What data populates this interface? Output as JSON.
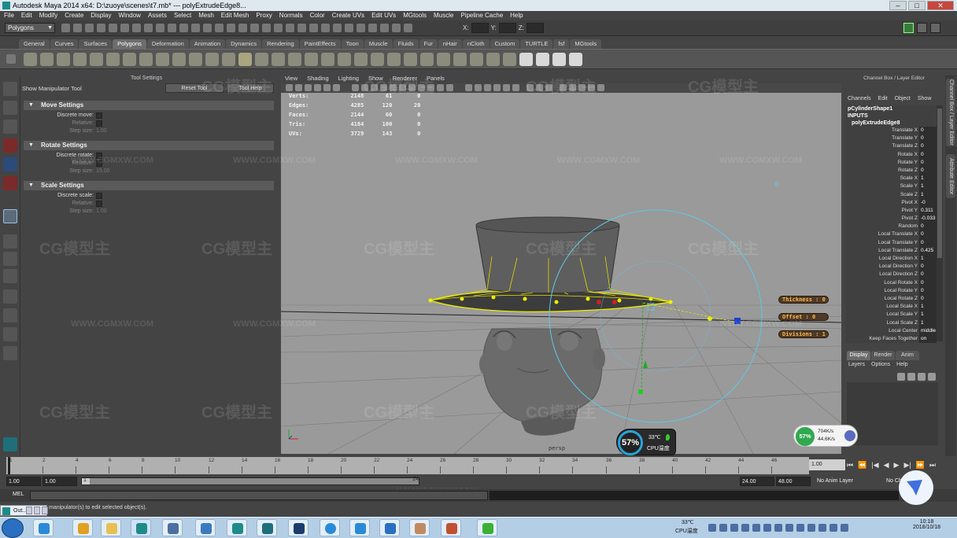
{
  "window": {
    "title": "Autodesk Maya 2014 x64: D:\\zuoye\\scenes\\t7.mb*   ---   polyExtrudeEdge8..."
  },
  "menubar": [
    "File",
    "Edit",
    "Modify",
    "Create",
    "Display",
    "Window",
    "Assets",
    "Select",
    "Mesh",
    "Edit Mesh",
    "Proxy",
    "Normals",
    "Color",
    "Create UVs",
    "Edit UVs",
    "MGtools",
    "Muscle",
    "Pipeline Cache",
    "Help"
  ],
  "status_line": {
    "mode": "Polygons",
    "x_label": "X:",
    "y_label": "Y:",
    "z_label": "Z:"
  },
  "shelf_tabs": [
    {
      "label": "General"
    },
    {
      "label": "Curves"
    },
    {
      "label": "Surfaces"
    },
    {
      "label": "Polygons",
      "active": true
    },
    {
      "label": "Deformation"
    },
    {
      "label": "Animation"
    },
    {
      "label": "Dynamics"
    },
    {
      "label": "Rendering"
    },
    {
      "label": "PaintEffects"
    },
    {
      "label": "Toon"
    },
    {
      "label": "Muscle"
    },
    {
      "label": "Fluids"
    },
    {
      "label": "Fur"
    },
    {
      "label": "nHair"
    },
    {
      "label": "nCloth"
    },
    {
      "label": "Custom"
    },
    {
      "label": "TURTLE"
    },
    {
      "label": "fsf"
    },
    {
      "label": "MGtools"
    }
  ],
  "tool_settings": {
    "title": "Tool Settings",
    "tool_name": "Show Manipulator Tool",
    "reset_label": "Reset Tool",
    "help_label": "Tool Help",
    "sections": [
      {
        "title": "Move Settings",
        "rows": [
          {
            "label": "Discrete move:",
            "kind": "check"
          },
          {
            "label": "Relative:",
            "kind": "check",
            "dim": true
          },
          {
            "label": "Step size:",
            "kind": "value",
            "value": "1.00",
            "dim": true
          }
        ]
      },
      {
        "title": "Rotate Settings",
        "rows": [
          {
            "label": "Discrete rotate:",
            "kind": "check"
          },
          {
            "label": "Relative:",
            "kind": "check",
            "dim": true
          },
          {
            "label": "Step size:",
            "kind": "value",
            "value": "15.00",
            "dim": true
          }
        ]
      },
      {
        "title": "Scale Settings",
        "rows": [
          {
            "label": "Discrete scale:",
            "kind": "check"
          },
          {
            "label": "Relative:",
            "kind": "check",
            "dim": true
          },
          {
            "label": "Step size:",
            "kind": "value",
            "value": "1.00",
            "dim": true
          }
        ]
      }
    ]
  },
  "viewport": {
    "menu": [
      "View",
      "Shading",
      "Lighting",
      "Show",
      "Renderer",
      "Panels"
    ],
    "camera": "persp",
    "hud": [
      {
        "label": "Verts:",
        "a": "2148",
        "b": "61",
        "c": "0"
      },
      {
        "label": "Edges:",
        "a": "4285",
        "b": "120",
        "c": "20"
      },
      {
        "label": "Faces:",
        "a": "2144",
        "b": "60",
        "c": "0"
      },
      {
        "label": "Tris:",
        "a": "4184",
        "b": "100",
        "c": "0"
      },
      {
        "label": "UVs:",
        "a": "3729",
        "b": "143",
        "c": "0"
      }
    ],
    "in_view_attrs": [
      {
        "label": "Thickness",
        "value": "0"
      },
      {
        "label": "Offset",
        "value": "0"
      },
      {
        "label": "Divisions",
        "value": "1"
      }
    ]
  },
  "channel_box": {
    "title": "Channel Box / Layer Editor",
    "menu": [
      "Channels",
      "Edit",
      "Object",
      "Show"
    ],
    "object": "pCylinderShape1",
    "inputs_label": "INPUTS",
    "node": "polyExtrudeEdge8",
    "attributes": [
      {
        "name": "Translate X",
        "value": "0"
      },
      {
        "name": "Translate Y",
        "value": "0"
      },
      {
        "name": "Translate Z",
        "value": "0"
      },
      {
        "name": "Rotate X",
        "value": "0"
      },
      {
        "name": "Rotate Y",
        "value": "0"
      },
      {
        "name": "Rotate Z",
        "value": "0"
      },
      {
        "name": "Scale X",
        "value": "1"
      },
      {
        "name": "Scale Y",
        "value": "1"
      },
      {
        "name": "Scale Z",
        "value": "1"
      },
      {
        "name": "Pivot X",
        "value": "-0"
      },
      {
        "name": "Pivot Y",
        "value": "0.311"
      },
      {
        "name": "Pivot Z",
        "value": "-0.033"
      },
      {
        "name": "Random",
        "value": "0"
      },
      {
        "name": "Local Translate X",
        "value": "0"
      },
      {
        "name": "Local Translate Y",
        "value": "0"
      },
      {
        "name": "Local Translate Z",
        "value": "0.425"
      },
      {
        "name": "Local Direction X",
        "value": "1"
      },
      {
        "name": "Local Direction Y",
        "value": "0"
      },
      {
        "name": "Local Direction Z",
        "value": "0"
      },
      {
        "name": "Local Rotate X",
        "value": "0"
      },
      {
        "name": "Local Rotate Y",
        "value": "0"
      },
      {
        "name": "Local Rotate Z",
        "value": "0"
      },
      {
        "name": "Local Scale X",
        "value": "1"
      },
      {
        "name": "Local Scale Y",
        "value": "1"
      },
      {
        "name": "Local Scale Z",
        "value": "1"
      },
      {
        "name": "Local Center",
        "value": "middle"
      },
      {
        "name": "Keep Faces Together",
        "value": "on"
      }
    ]
  },
  "side_tabs": [
    "Channel Box / Layer Editor",
    "Attribute Editor"
  ],
  "layer_editor": {
    "tabs": [
      "Display",
      "Render",
      "Anim"
    ],
    "menu": [
      "Layers",
      "Options",
      "Help"
    ]
  },
  "timeline": {
    "ticks": [
      "1",
      "2",
      "4",
      "6",
      "8",
      "10",
      "12",
      "14",
      "16",
      "18",
      "20",
      "22",
      "24",
      "26",
      "28",
      "30",
      "32",
      "34",
      "36",
      "38",
      "40",
      "42",
      "44",
      "46"
    ],
    "current_frame": "1.00",
    "range": {
      "start": "1.00",
      "inner_start": "1.00",
      "slider_start": "1",
      "slider_end": "24",
      "end": "24.00",
      "outer_end": "48.00"
    },
    "anim_layer": "No Anim Layer",
    "char_set": "No Ch"
  },
  "command_line": {
    "label": "MEL"
  },
  "help_line": {
    "text": "manipulator(s) to edit selected object(s)."
  },
  "minimized": {
    "label": "Out..."
  },
  "cpu_widget": {
    "percent": "57%",
    "temperature": "33℃",
    "label": "CPU温度"
  },
  "net_widget": {
    "percent": "57%",
    "up": "704K/s",
    "down": "44.6K/s"
  },
  "taskbar": {
    "tray_temp": "33℃",
    "tray_label": "CPU温度",
    "time": "10:18",
    "date": "2018/10/18"
  },
  "watermark": {
    "brand": "CG模型主",
    "url": "WWW.CGMXW.COM"
  },
  "colors": {
    "viewport_bg": "#9a9a9a",
    "ui_bg": "#444444",
    "selection_yellow": "#f0f000",
    "manip_cyan": "#5fc8e8",
    "hud_attr_orange": "#ffb64a"
  }
}
